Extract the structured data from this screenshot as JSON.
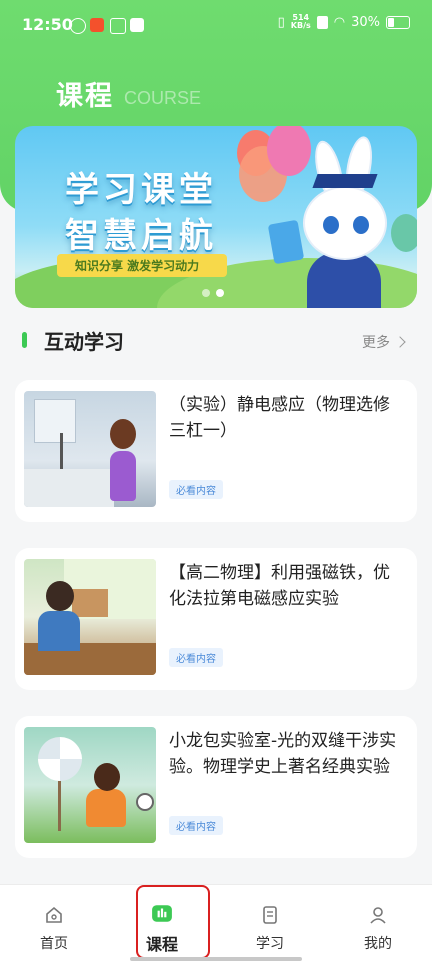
{
  "status_bar": {
    "time": "12:50",
    "net_speed_value": "514",
    "net_speed_unit": "KB/s",
    "battery": "30%"
  },
  "header": {
    "title": "课程",
    "subtitle": "COURSE"
  },
  "banner": {
    "line1": "学习课堂",
    "line2": "智慧启航",
    "slogan": "知识分享 激发学习动力",
    "slide_count": 2,
    "active_slide": 2
  },
  "section": {
    "title": "互动学习",
    "more_label": "更多"
  },
  "courses": [
    {
      "title": "（实验）静电感应（物理选修三杠一）",
      "tag": "必看内容"
    },
    {
      "title": "【高二物理】利用强磁铁，优化法拉第电磁感应实验",
      "tag": "必看内容"
    },
    {
      "title": "小龙包实验室-光的双缝干涉实验。物理学史上著名经典实验",
      "tag": "必看内容"
    }
  ],
  "tabbar": {
    "items": [
      {
        "label": "首页",
        "icon": "home-icon"
      },
      {
        "label": "课程",
        "icon": "course-icon"
      },
      {
        "label": "学习",
        "icon": "study-icon"
      },
      {
        "label": "我的",
        "icon": "profile-icon"
      }
    ],
    "active": "课程"
  },
  "colors": {
    "brand_green": "#62d366",
    "tag_blue": "#4a8ad8",
    "highlight_red": "#d92020"
  }
}
